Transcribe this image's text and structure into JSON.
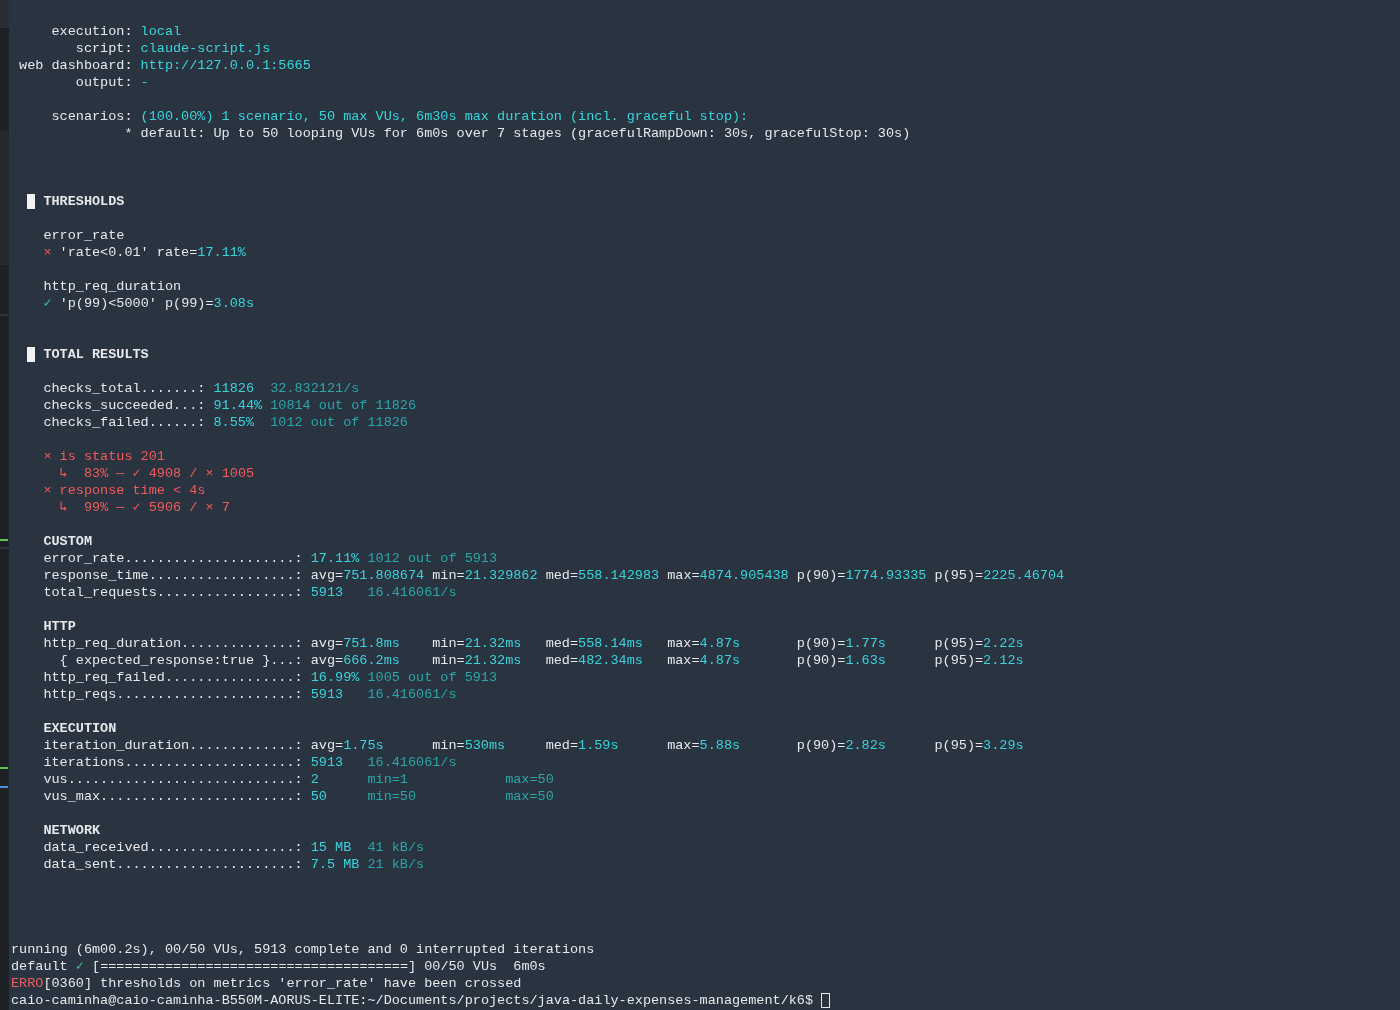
{
  "options": [
    {
      "key": "execution:",
      "value": "local"
    },
    {
      "key": "script:",
      "value": "claude-script.js"
    },
    {
      "key": "web dashboard:",
      "value": "http://127.0.0.1:5665"
    },
    {
      "key": "output:",
      "value": "-"
    }
  ],
  "scenarios": {
    "key": "scenarios:",
    "summary": "(100.00%) 1 scenario, 50 max VUs, 6m30s max duration (incl. graceful stop):",
    "details": [
      "* default: Up to 50 looping VUs for 6m0s over 7 stages (gracefulRampDown: 30s, gracefulStop: 30s)"
    ]
  },
  "thresholds": {
    "title": "THRESHOLDS",
    "metrics": [
      {
        "name": "error_rate",
        "rules": [
          {
            "passed": false,
            "mark": "×",
            "condition": "'rate<0.01' rate=",
            "value": "17.11%"
          }
        ]
      },
      {
        "name": "http_req_duration",
        "rules": [
          {
            "passed": true,
            "mark": "✓",
            "condition": "'p(99)<5000' p(99)=",
            "value": "3.08s"
          }
        ]
      }
    ]
  },
  "results": {
    "title": "TOTAL RESULTS",
    "checks": [
      {
        "kind": "value",
        "name": "checks_total.......:",
        "value": "11826",
        "details": [
          "32.832121/s"
        ]
      },
      {
        "kind": "value",
        "name": "checks_succeeded...:",
        "value": "91.44%",
        "details": [
          "10814 out of 11826"
        ]
      },
      {
        "kind": "value",
        "name": "checks_failed......:",
        "value": "8.55%",
        "details": [
          "1012 out of 11826"
        ]
      }
    ],
    "failed_checks": [
      {
        "passed": false,
        "mark": "×",
        "name": "is status 201",
        "breakdown": "↳  83% — ✓ 4908 / × 1005"
      },
      {
        "passed": false,
        "mark": "×",
        "name": "response time < 4s",
        "breakdown": "↳  99% — ✓ 5906 / × 7"
      }
    ],
    "groups": [
      {
        "title": "CUSTOM",
        "rows": [
          {
            "kind": "value",
            "name": "error_rate.....................:",
            "value": "17.11%",
            "details": [
              "1012 out of 5913"
            ]
          },
          {
            "kind": "pairs",
            "name": "response_time..................:",
            "stats": [
              {
                "key": "avg=",
                "value": "751.808674"
              },
              {
                "key": "min=",
                "value": "21.329862"
              },
              {
                "key": "med=",
                "value": "558.142983"
              },
              {
                "key": "max=",
                "value": "4874.905438"
              },
              {
                "key": "p(90)=",
                "value": "1774.93335"
              },
              {
                "key": "p(95)=",
                "value": "2225.46704"
              }
            ]
          },
          {
            "kind": "value",
            "name": "total_requests.................:",
            "value": "5913",
            "details": [
              "16.416061/s"
            ]
          }
        ]
      },
      {
        "title": "HTTP",
        "rows": [
          {
            "kind": "stats",
            "name": "http_req_duration..............:",
            "stats": [
              {
                "key": "avg=",
                "value": "751.8ms"
              },
              {
                "key": "min=",
                "value": "21.32ms"
              },
              {
                "key": "med=",
                "value": "558.14ms"
              },
              {
                "key": "max=",
                "value": "4.87s"
              },
              {
                "key": "p(90)=",
                "value": "1.77s"
              },
              {
                "key": "p(95)=",
                "value": "2.22s"
              }
            ],
            "children": [
              {
                "kind": "stats",
                "name": "{ expected_response:true }...:",
                "stats": [
                  {
                    "key": "avg=",
                    "value": "666.2ms"
                  },
                  {
                    "key": "min=",
                    "value": "21.32ms"
                  },
                  {
                    "key": "med=",
                    "value": "482.34ms"
                  },
                  {
                    "key": "max=",
                    "value": "4.87s"
                  },
                  {
                    "key": "p(90)=",
                    "value": "1.63s"
                  },
                  {
                    "key": "p(95)=",
                    "value": "2.12s"
                  }
                ]
              }
            ]
          },
          {
            "kind": "value",
            "name": "http_req_failed................:",
            "value": "16.99%",
            "details": [
              "1005 out of 5913"
            ]
          },
          {
            "kind": "value",
            "name": "http_reqs......................:",
            "value": "5913",
            "details": [
              "16.416061/s"
            ]
          }
        ]
      },
      {
        "title": "EXECUTION",
        "rows": [
          {
            "kind": "stats",
            "name": "iteration_duration.............:",
            "stats": [
              {
                "key": "avg=",
                "value": "1.75s"
              },
              {
                "key": "min=",
                "value": "530ms"
              },
              {
                "key": "med=",
                "value": "1.59s"
              },
              {
                "key": "max=",
                "value": "5.88s"
              },
              {
                "key": "p(90)=",
                "value": "2.82s"
              },
              {
                "key": "p(95)=",
                "value": "3.29s"
              }
            ]
          },
          {
            "kind": "value",
            "name": "iterations.....................:",
            "value": "5913",
            "details": [
              "16.416061/s"
            ]
          },
          {
            "kind": "value",
            "name": "vus............................:",
            "value": "2",
            "details": [
              "min=1",
              "max=50"
            ]
          },
          {
            "kind": "value",
            "name": "vus_max........................:",
            "value": "50",
            "details": [
              "min=50",
              "max=50"
            ]
          }
        ]
      },
      {
        "title": "NETWORK",
        "rows": [
          {
            "kind": "value",
            "name": "data_received..................:",
            "value": "15 MB",
            "details": [
              "41 kB/s"
            ]
          },
          {
            "kind": "value",
            "name": "data_sent......................:",
            "value": "7.5 MB",
            "details": [
              "21 kB/s"
            ]
          }
        ]
      }
    ]
  },
  "status": {
    "summary": "running (6m00.2s), 00/50 VUs, 5913 complete and 0 interrupted iterations",
    "scenario": {
      "name": "default",
      "passed": true,
      "mark": "✓",
      "progress": "[======================================] 00/50 VUs  6m0s"
    },
    "error": {
      "tag": "ERRO",
      "message": "[0360] thresholds on metrics 'error_rate' have been crossed"
    },
    "prompt": "caio-caminha@caio-caminha-B550M-AORUS-ELITE:~/Documents/projects/java-daily-expenses-management/k6$"
  }
}
